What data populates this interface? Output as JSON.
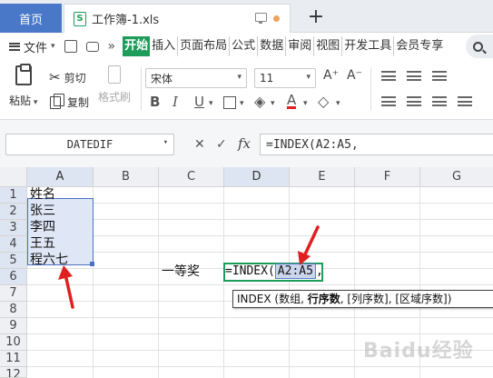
{
  "tabs": {
    "home": "首页",
    "file_icon": "S",
    "file_name": "工作簿-1.xls",
    "new_tab": "+"
  },
  "menu": {
    "file_label": "文件",
    "more": "»",
    "tabs": [
      "开始",
      "插入",
      "页面布局",
      "公式",
      "数据",
      "审阅",
      "视图",
      "开发工具",
      "会员专享"
    ],
    "active_tab": "开始"
  },
  "ribbon": {
    "paste": "粘贴",
    "cut": "剪切",
    "copy": "复制",
    "format_painter": "格式刷",
    "font_name": "宋体",
    "font_size": "11",
    "grow_font": "A⁺",
    "shrink_font": "A⁻",
    "bold": "B",
    "italic": "I",
    "underline": "U",
    "font_color": "A"
  },
  "formula_bar": {
    "name_box": "DATEDIF",
    "cancel": "✕",
    "confirm": "✓",
    "fx": "fx",
    "content": "=INDEX(A2:A5,"
  },
  "columns": [
    "A",
    "B",
    "C",
    "D",
    "E",
    "F",
    "G"
  ],
  "rows": [
    "1",
    "2",
    "3",
    "4",
    "5",
    "6",
    "7",
    "8",
    "9",
    "10",
    "11",
    "12"
  ],
  "cells": {
    "A1": "姓名",
    "A2": "张三",
    "A3": "李四",
    "A4": "王五",
    "A5": "程六七",
    "C6": "一等奖"
  },
  "editing": {
    "prefix": "=INDEX(",
    "ref": "A2:A5",
    "suffix": ","
  },
  "tooltip": {
    "func": "INDEX",
    "open": "(",
    "arg1": "数组,",
    "arg2": "行序数",
    "rest": ", [列序数], [区域序数])"
  },
  "watermark": "Baidu经验",
  "colors": {
    "accent_green": "#1e9c5a",
    "home_tab_blue": "#4a78c9",
    "selection_blue": "#4a72c4",
    "arrow_red": "#e02020"
  }
}
